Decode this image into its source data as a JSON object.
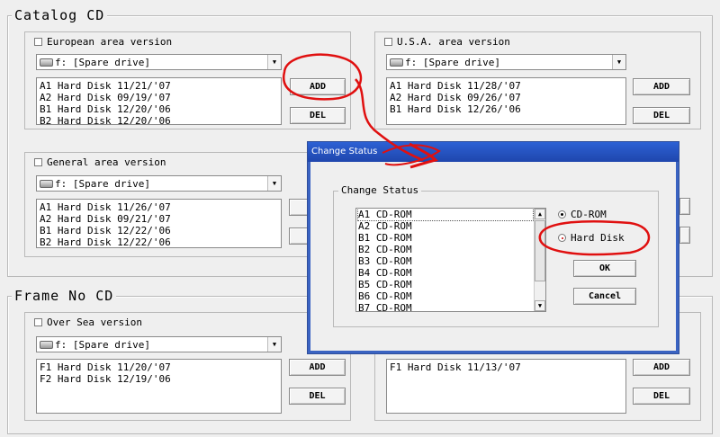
{
  "catalog": {
    "title": "Catalog  CD",
    "european": {
      "label": "European area version",
      "drive": "f: [Spare drive]",
      "items": [
        "A1 Hard Disk 11/21/'07",
        "A2 Hard Disk 09/19/'07",
        "B1 Hard Disk 12/20/'06",
        "B2 Hard Disk 12/20/'06"
      ],
      "add": "ADD",
      "del": "DEL"
    },
    "usa": {
      "label": "U.S.A. area version",
      "drive": "f: [Spare drive]",
      "items": [
        "A1 Hard Disk 11/28/'07",
        "A2 Hard Disk 09/26/'07",
        "B1 Hard Disk 12/26/'06"
      ],
      "add": "ADD",
      "del": "DEL"
    },
    "general": {
      "label": "General area version",
      "drive": "f: [Spare drive]",
      "items": [
        "A1 Hard Disk 11/26/'07",
        "A2 Hard Disk 09/21/'07",
        "B1 Hard Disk 12/22/'06",
        "B2 Hard Disk 12/22/'06"
      ]
    }
  },
  "frame": {
    "title": "Frame No CD",
    "oversea": {
      "label": "Over Sea version",
      "drive": "f: [Spare drive]",
      "items": [
        "F1 Hard Disk 11/20/'07",
        "F2 Hard Disk 12/19/'06"
      ],
      "add": "ADD",
      "del": "DEL"
    },
    "right": {
      "items": [
        "F1 Hard Disk 11/13/'07"
      ],
      "add": "ADD",
      "del": "DEL"
    }
  },
  "dialog": {
    "title": "Change Status",
    "group_label": "Change Status",
    "items": [
      "A1 CD-ROM",
      "A2 CD-ROM",
      "B1 CD-ROM",
      "B2 CD-ROM",
      "B3 CD-ROM",
      "B4 CD-ROM",
      "B5 CD-ROM",
      "B6 CD-ROM",
      "B7 CD-ROM"
    ],
    "option_cdrom": "CD-ROM",
    "option_hdd": "Hard Disk",
    "ok": "OK",
    "cancel": "Cancel"
  },
  "colors": {
    "annotation": "#e01010",
    "title_bar": "#1f46ad"
  }
}
